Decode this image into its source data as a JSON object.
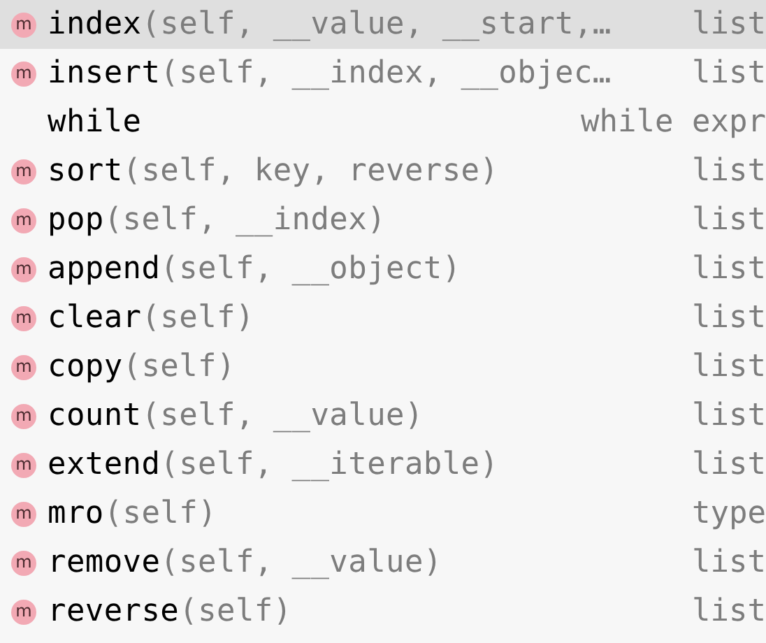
{
  "completions": [
    {
      "kind": "method",
      "icon": "m",
      "name": "index",
      "params": "(self, __value, __start,…",
      "type": "list",
      "selected": true
    },
    {
      "kind": "method",
      "icon": "m",
      "name": "insert",
      "params": "(self, __index, __objec…",
      "type": "list",
      "selected": false
    },
    {
      "kind": "keyword",
      "name": "while",
      "type": "while expr",
      "selected": false
    },
    {
      "kind": "method",
      "icon": "m",
      "name": "sort",
      "params": "(self, key, reverse)",
      "type": "list",
      "selected": false
    },
    {
      "kind": "method",
      "icon": "m",
      "name": "pop",
      "params": "(self, __index)",
      "type": "list",
      "selected": false
    },
    {
      "kind": "method",
      "icon": "m",
      "name": "append",
      "params": "(self, __object)",
      "type": "list",
      "selected": false
    },
    {
      "kind": "method",
      "icon": "m",
      "name": "clear",
      "params": "(self)",
      "type": "list",
      "selected": false
    },
    {
      "kind": "method",
      "icon": "m",
      "name": "copy",
      "params": "(self)",
      "type": "list",
      "selected": false
    },
    {
      "kind": "method",
      "icon": "m",
      "name": "count",
      "params": "(self, __value)",
      "type": "list",
      "selected": false
    },
    {
      "kind": "method",
      "icon": "m",
      "name": "extend",
      "params": "(self, __iterable)",
      "type": "list",
      "selected": false
    },
    {
      "kind": "method",
      "icon": "m",
      "name": "mro",
      "params": "(self)",
      "type": "type",
      "selected": false
    },
    {
      "kind": "method",
      "icon": "m",
      "name": "remove",
      "params": "(self, __value)",
      "type": "list",
      "selected": false
    },
    {
      "kind": "method",
      "icon": "m",
      "name": "reverse",
      "params": "(self)",
      "type": "list",
      "selected": false
    }
  ]
}
